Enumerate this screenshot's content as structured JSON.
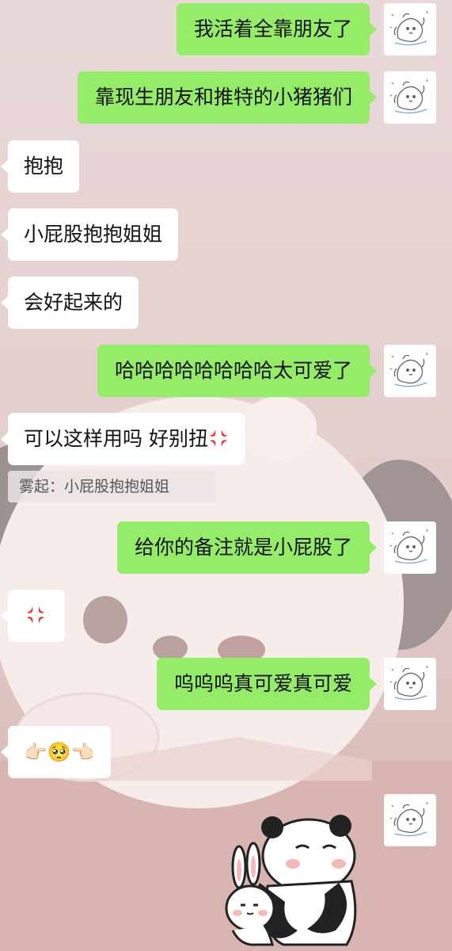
{
  "wallpaper": {
    "colors": {
      "background_top": "#e6d6d6",
      "background_bottom": "#d8b4b1",
      "panda_body": "#fbf1ef",
      "panda_ear": "#a19595"
    }
  },
  "colors": {
    "outgoing_bubble": "#95ec69",
    "incoming_bubble": "#ffffff",
    "anger_emoji": "#e8333a"
  },
  "messages": [
    {
      "direction": "out",
      "text": "我活着全靠朋友了"
    },
    {
      "direction": "out",
      "text": "靠现生朋友和推特的小猪猪们"
    },
    {
      "direction": "in",
      "text": "抱抱"
    },
    {
      "direction": "in",
      "text": "小屁股抱抱姐姐"
    },
    {
      "direction": "in",
      "text": "会好起来的"
    },
    {
      "direction": "out",
      "text": "哈哈哈哈哈哈哈哈太可爱了"
    },
    {
      "direction": "in",
      "text": "可以这样用吗 好别扭",
      "emoji": "anger-symbol-icon"
    },
    {
      "direction": "out",
      "text": "给你的备注就是小屁股了"
    },
    {
      "direction": "in",
      "text": "",
      "emoji": "anger-symbol-icon"
    },
    {
      "direction": "out",
      "text": "呜呜呜真可爱真可爱"
    },
    {
      "direction": "in",
      "text": "👉🏻🥺👈🏻"
    }
  ],
  "quote": {
    "text": "雾起：小屁股抱抱姐姐"
  },
  "sticker": {
    "icon": "panda-hugging-bunny-sticker"
  },
  "avatar": {
    "icon": "sketch-animal-avatar-icon"
  }
}
